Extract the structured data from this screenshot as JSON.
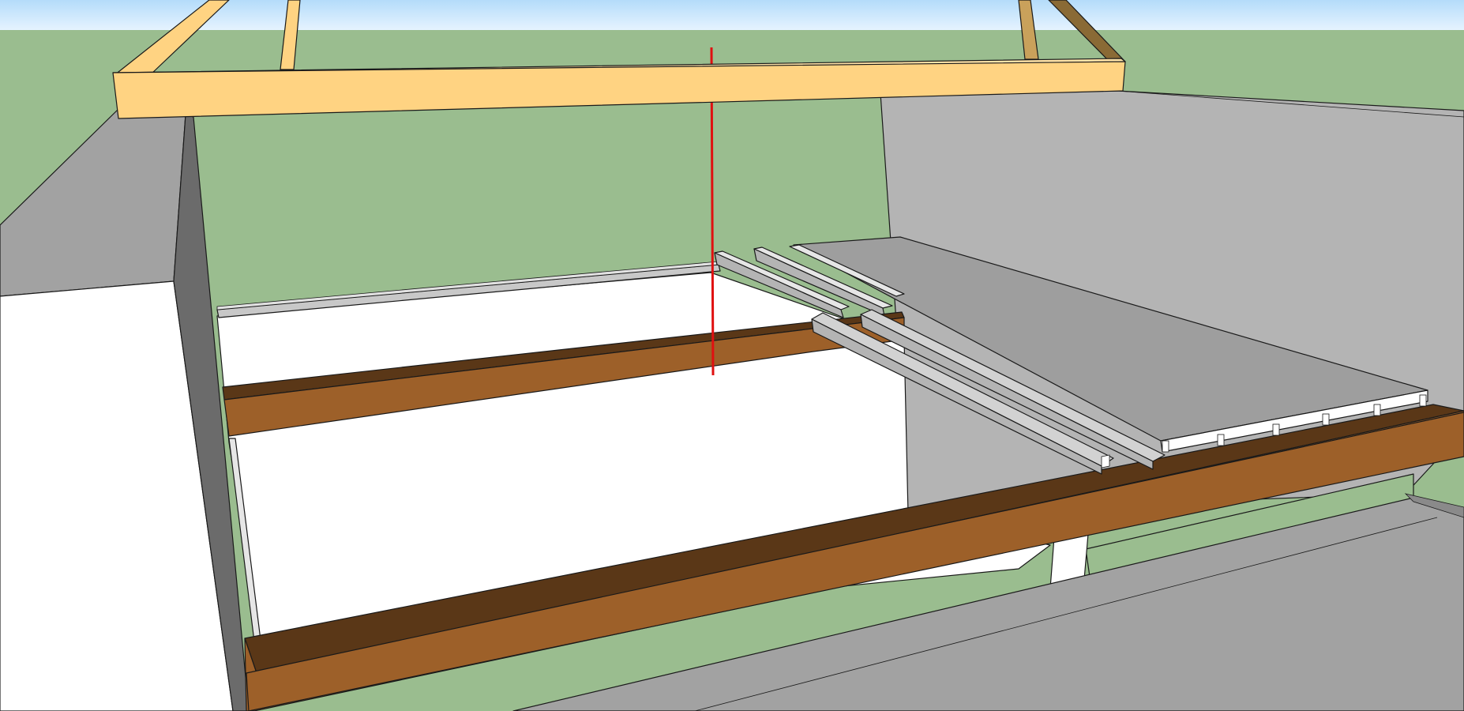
{
  "viewport": {
    "name": "3d-model-viewport",
    "sky_color": "#dceefe",
    "ground_color": "#9abd8f"
  },
  "materials": {
    "light_wood": "#ffd382",
    "light_wood_dark": "#c9a15b",
    "brown_beam_face": "#9d6029",
    "brown_beam_top": "#5a3717",
    "wall_light": "#b4b4b4",
    "wall_mid": "#a2a2a2",
    "wall_dark": "#6b6b6b",
    "white_surface": "#ffffff",
    "concrete_slab": "#9e9e9e",
    "joist_light": "#d2d2d2",
    "axis_red": "#e01010"
  }
}
